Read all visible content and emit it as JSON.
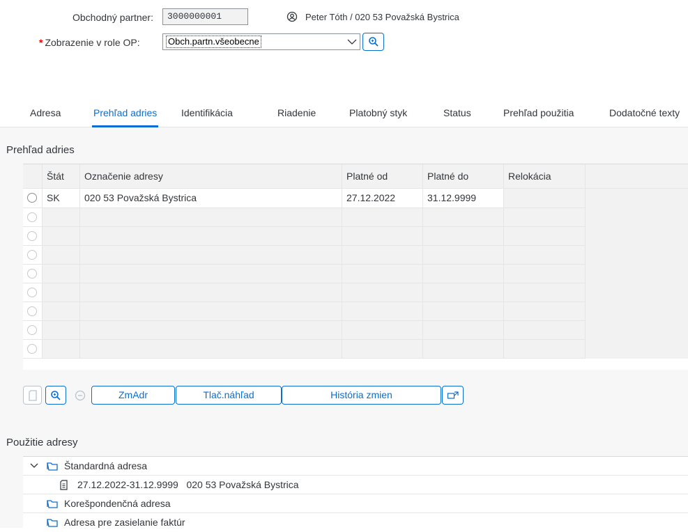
{
  "header": {
    "partner_label": "Obchodný partner:",
    "partner_value": "3000000001",
    "partner_name": "Peter Tóth / 020 53 Považská Bystrica",
    "required_mark": "*",
    "role_label": "Zobrazenie v role OP:",
    "role_value": "Obch.partn.všeobecne"
  },
  "tabs": [
    {
      "label": "Adresa"
    },
    {
      "label": "Prehľad adries"
    },
    {
      "label": "Identifikácia"
    },
    {
      "label": "Riadenie"
    },
    {
      "label": "Platobný styk"
    },
    {
      "label": "Status"
    },
    {
      "label": "Prehľad použitia"
    },
    {
      "label": "Dodatočné texty"
    }
  ],
  "address_overview": {
    "title": "Prehľad adries",
    "columns": [
      "Štát",
      "Označenie adresy",
      "Platné od",
      "Platné do",
      "Relokácia"
    ],
    "rows": [
      {
        "country": "SK",
        "designation": "020 53 Považská Bystrica",
        "valid_from": "27.12.2022",
        "valid_to": "31.12.9999",
        "relocation": ""
      }
    ]
  },
  "toolbar": {
    "change_label": "ZmAdr",
    "print_preview_label": "Tlač.náhľad",
    "history_label": "História zmien"
  },
  "usage": {
    "title": "Použitie adresy",
    "items": [
      {
        "label": "Štandardná adresa"
      },
      {
        "label": "27.12.2022-31.12.9999   020 53 Považská Bystrica"
      },
      {
        "label": "Korešpondenčná adresa"
      },
      {
        "label": "Adresa pre zasielanie faktúr"
      }
    ]
  },
  "colors": {
    "accent": "#0a6ed1",
    "required": "#e00000"
  }
}
